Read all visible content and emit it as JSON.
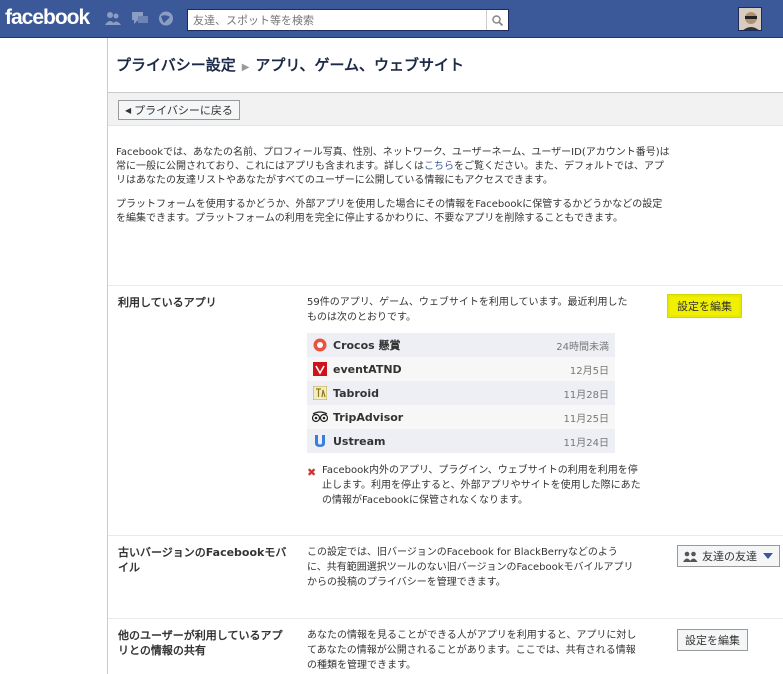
{
  "topbar": {
    "logo": "facebook",
    "search_placeholder": "友達、スポット等を検索"
  },
  "page": {
    "title": "プライバシー設定",
    "subtitle": "アプリ、ゲーム、ウェブサイト",
    "back_label": "プライバシーに戻る"
  },
  "intro": {
    "p1_a": "Facebookでは、あなたの名前、プロフィール写真、性別、ネットワーク、ユーザーネーム、ユーザーID(アカウント番号)は常に一般に公開されており、これにはアプリも含まれます。詳しくは",
    "p1_link": "こちら",
    "p1_b": "をご覧ください。また、デフォルトでは、アプリはあなたの友達リストやあなたがすべてのユーザーに公開している情報にもアクセスできます。",
    "p2": "プラットフォームを使用するかどうか、外部アプリを使用した場合にその情報をFacebookに保管するかどうかなどの設定を編集できます。プラットフォームの利用を完全に停止するかわりに、不要なアプリを削除することもできます。"
  },
  "apps_section": {
    "label": "利用しているアプリ",
    "desc": "59件のアプリ、ゲーム、ウェブサイトを利用しています。最近利用したものは次のとおりです。",
    "edit_label": "設定を編集",
    "apps": [
      {
        "name": "Crocos 懸賞",
        "date": "24時間未満",
        "icon": "crocos-icon"
      },
      {
        "name": "eventATND",
        "date": "12月5日",
        "icon": "eventatnd-icon"
      },
      {
        "name": "Tabroid",
        "date": "11月28日",
        "icon": "tabroid-icon"
      },
      {
        "name": "TripAdvisor",
        "date": "11月25日",
        "icon": "tripadvisor-icon"
      },
      {
        "name": "Ustream",
        "date": "11月24日",
        "icon": "ustream-icon"
      }
    ],
    "remove_note": "Facebook内外のアプリ、プラグイン、ウェブサイトの利用を利用を停止します。利用を停止すると、外部アプリやサイトを使用した際にあたの情報がFacebookに保管されなくなります。"
  },
  "mobile_section": {
    "label": "古いバージョンのFacebookモバイル",
    "desc": "この設定では、旧バージョンのFacebook for BlackBerryなどのように、共有範囲選択ツールのない旧バージョンのFacebookモバイルアプリからの投稿のプライバシーを管理できます。",
    "dropdown_label": "友達の友達"
  },
  "share_section": {
    "label": "他のユーザーが利用しているアプリとの情報の共有",
    "desc": "あなたの情報を見ることができる人がアプリを利用すると、アプリに対してあなたの情報が公開されることがあります。ここでは、共有される情報の種類を管理できます。",
    "edit_label": "設定を編集"
  },
  "colors": {
    "header_blue": "#3b5998",
    "highlight_yellow": "#f0f000"
  }
}
